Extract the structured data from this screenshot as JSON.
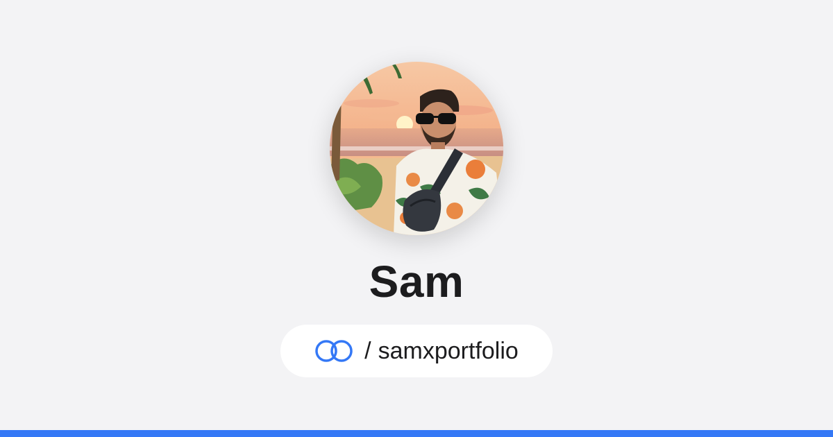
{
  "profile": {
    "name": "Sam",
    "avatar_icon": "profile-photo-beach-sunset"
  },
  "link": {
    "icon": "linked-rings-icon",
    "separator": "/",
    "handle": "samxportfolio"
  },
  "colors": {
    "background": "#f3f3f5",
    "accent": "#3478f6",
    "text": "#1c1c1e",
    "pill": "#ffffff"
  }
}
